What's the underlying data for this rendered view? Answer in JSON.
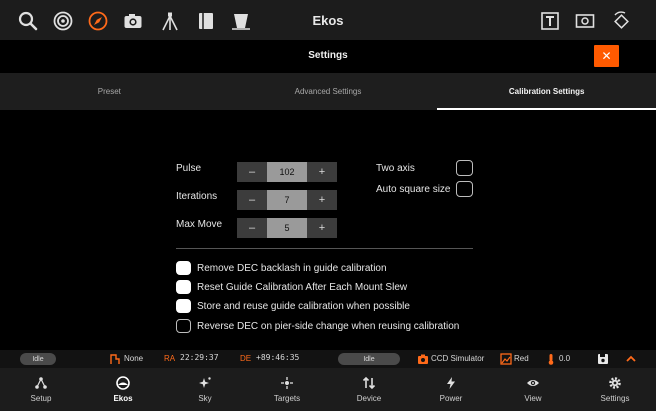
{
  "toolbar": {
    "title": "Ekos",
    "accent": "#ff6a1a",
    "left_icons": [
      "search-icon",
      "target-icon",
      "compass-icon",
      "camera-icon",
      "tripod-icon",
      "notebook-icon",
      "filter-icon"
    ],
    "right_icons": [
      "text-frame-icon",
      "image-frame-icon",
      "rotate-icon"
    ]
  },
  "settings": {
    "title": "Settings",
    "close_label": "✕",
    "close_color": "#ff5a00"
  },
  "tabs": [
    {
      "label": "Preset",
      "active": false
    },
    {
      "label": "Advanced Settings",
      "active": false
    },
    {
      "label": "Calibration Settings",
      "active": true
    }
  ],
  "calibration": {
    "pulse": {
      "label": "Pulse",
      "value": "102"
    },
    "iterations": {
      "label": "Iterations",
      "value": "7"
    },
    "max_move": {
      "label": "Max Move",
      "value": "5"
    },
    "minus": "–",
    "plus": "+",
    "two_axis": {
      "label": "Two axis",
      "checked": false
    },
    "auto_square": {
      "label": "Auto square size",
      "checked": false
    },
    "options": [
      {
        "label": "Remove DEC backlash in guide calibration",
        "checked": true
      },
      {
        "label": "Reset Guide Calibration After Each Mount Slew",
        "checked": true
      },
      {
        "label": "Store and reuse guide calibration when possible",
        "checked": true
      },
      {
        "label": "Reverse DEC on pier-side change when reusing calibration",
        "checked": false
      }
    ]
  },
  "status": {
    "mount_state": "Idle",
    "tracking": "None",
    "ra_label": "RA",
    "ra_value": "22:29:37",
    "de_label": "DE",
    "de_value": "+89:46:35",
    "camera_state": "Idle",
    "camera": "CCD Simulator",
    "filter": "Red",
    "temperature": "0.0"
  },
  "bottom_nav": [
    {
      "label": "Setup",
      "icon": "setup-icon",
      "active": false
    },
    {
      "label": "Ekos",
      "icon": "ekos-icon",
      "active": true
    },
    {
      "label": "Sky",
      "icon": "sky-icon",
      "active": false
    },
    {
      "label": "Targets",
      "icon": "targets-icon",
      "active": false
    },
    {
      "label": "Device",
      "icon": "device-icon",
      "active": false
    },
    {
      "label": "Power",
      "icon": "power-icon",
      "active": false
    },
    {
      "label": "View",
      "icon": "view-icon",
      "active": false
    },
    {
      "label": "Settings",
      "icon": "settings-icon",
      "active": false
    }
  ]
}
